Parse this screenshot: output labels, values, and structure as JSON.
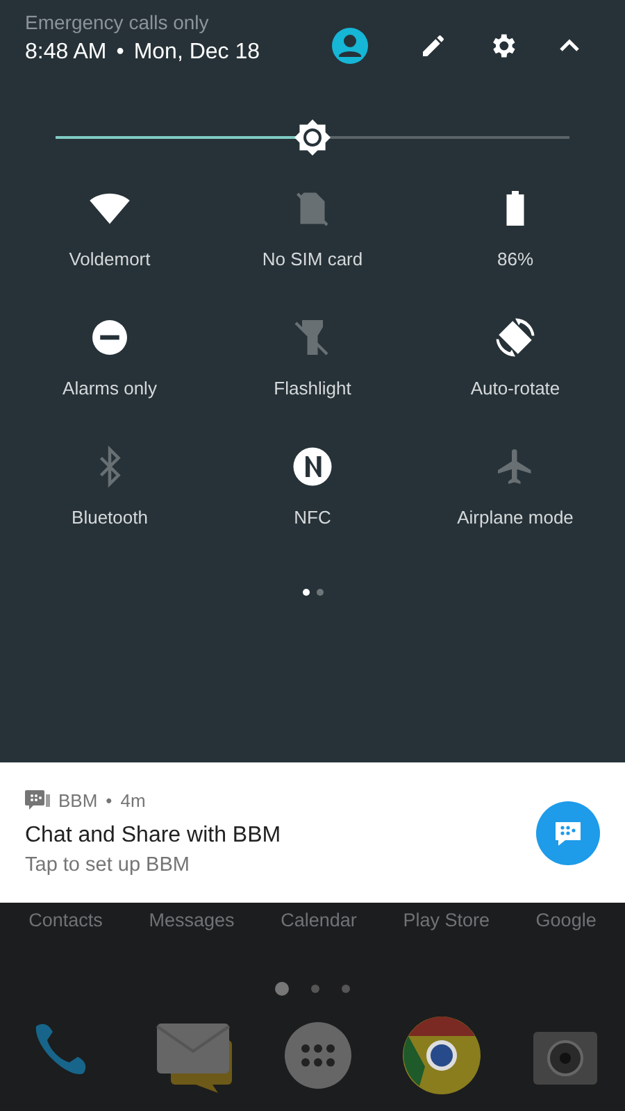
{
  "status": {
    "carrier": "Emergency calls only",
    "time": "8:48 AM",
    "separator": "•",
    "date": "Mon, Dec 18"
  },
  "brightness": {
    "level": 0.5
  },
  "tiles": [
    {
      "kind": "wifi",
      "label": "Voldemort",
      "on": true
    },
    {
      "kind": "sim",
      "label": "No SIM card",
      "on": false
    },
    {
      "kind": "battery",
      "label": "86%",
      "on": true
    },
    {
      "kind": "dnd",
      "label": "Alarms only",
      "on": true
    },
    {
      "kind": "flashlight",
      "label": "Flashlight",
      "on": false
    },
    {
      "kind": "rotate",
      "label": "Auto-rotate",
      "on": true
    },
    {
      "kind": "bluetooth",
      "label": "Bluetooth",
      "on": false
    },
    {
      "kind": "nfc",
      "label": "NFC",
      "on": true
    },
    {
      "kind": "airplane",
      "label": "Airplane mode",
      "on": false
    }
  ],
  "tile_pages": [
    {
      "selected": true
    },
    {
      "selected": false
    }
  ],
  "notification": {
    "app": "BBM",
    "separator": "•",
    "age": "4m",
    "title": "Chat and Share with BBM",
    "text": "Tap to set up BBM"
  },
  "home": {
    "labels": [
      "Contacts",
      "Messages",
      "Calendar",
      "Play Store",
      "Google"
    ],
    "pages": [
      {
        "selected": true
      },
      {
        "selected": false
      },
      {
        "selected": false
      }
    ],
    "dock": [
      {
        "kind": "phone"
      },
      {
        "kind": "mail"
      },
      {
        "kind": "apps"
      },
      {
        "kind": "browser"
      },
      {
        "kind": "camera"
      }
    ]
  }
}
